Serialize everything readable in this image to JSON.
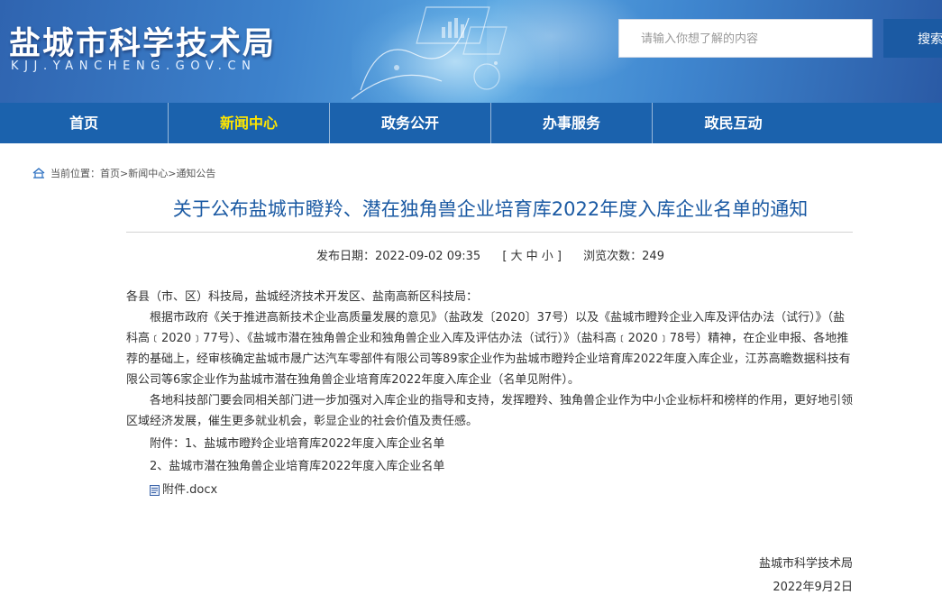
{
  "header": {
    "site_title": "盐城市科学技术局",
    "site_domain": "KJJ.YANCHENG.GOV.CN",
    "search": {
      "placeholder": "请输入你想了解的内容",
      "button_label": "搜索"
    }
  },
  "nav": {
    "items": [
      {
        "label": "首页"
      },
      {
        "label": "新闻中心",
        "active": true
      },
      {
        "label": "政务公开"
      },
      {
        "label": "办事服务"
      },
      {
        "label": "政民互动"
      }
    ]
  },
  "breadcrumb": {
    "prefix": "当前位置：",
    "items": [
      "首页",
      "新闻中心",
      "通知公告"
    ]
  },
  "article": {
    "title": "关于公布盐城市瞪羚、潜在独角兽企业培育库2022年度入库企业名单的通知",
    "meta": {
      "date_label": "发布日期：",
      "date": "2022-09-02 09:35",
      "font_size_control": "[ 大 中 小 ]",
      "views_label": "浏览次数：",
      "views": "249"
    },
    "salutation": "各县（市、区）科技局，盐城经济技术开发区、盐南高新区科技局：",
    "paragraphs": [
      "根据市政府《关于推进高新技术企业高质量发展的意见》（盐政发〔2020〕37号）以及《盐城市瞪羚企业入库及评估办法（试行）》（盐科高﹝2020﹞77号）、《盐城市潜在独角兽企业和独角兽企业入库及评估办法（试行）》（盐科高﹝2020﹞78号）精神，在企业申报、各地推荐的基础上，经审核确定盐城市晟广达汽车零部件有限公司等89家企业作为盐城市瞪羚企业培育库2022年度入库企业，江苏高瞻数据科技有限公司等6家企业作为盐城市潜在独角兽企业培育库2022年度入库企业（名单见附件）。",
      "各地科技部门要会同相关部门进一步加强对入库企业的指导和支持，发挥瞪羚、独角兽企业作为中小企业标杆和榜样的作用，更好地引领区域经济发展，催生更多就业机会，彰显企业的社会价值及责任感。"
    ],
    "attachments": [
      "附件：1、盐城市瞪羚企业培育库2022年度入库企业名单",
      "2、盐城市潜在独角兽企业培育库2022年度入库企业名单"
    ],
    "attachment_file": "附件.docx",
    "signature": {
      "org": "盐城市科学技术局",
      "date": "2022年9月2日"
    }
  }
}
